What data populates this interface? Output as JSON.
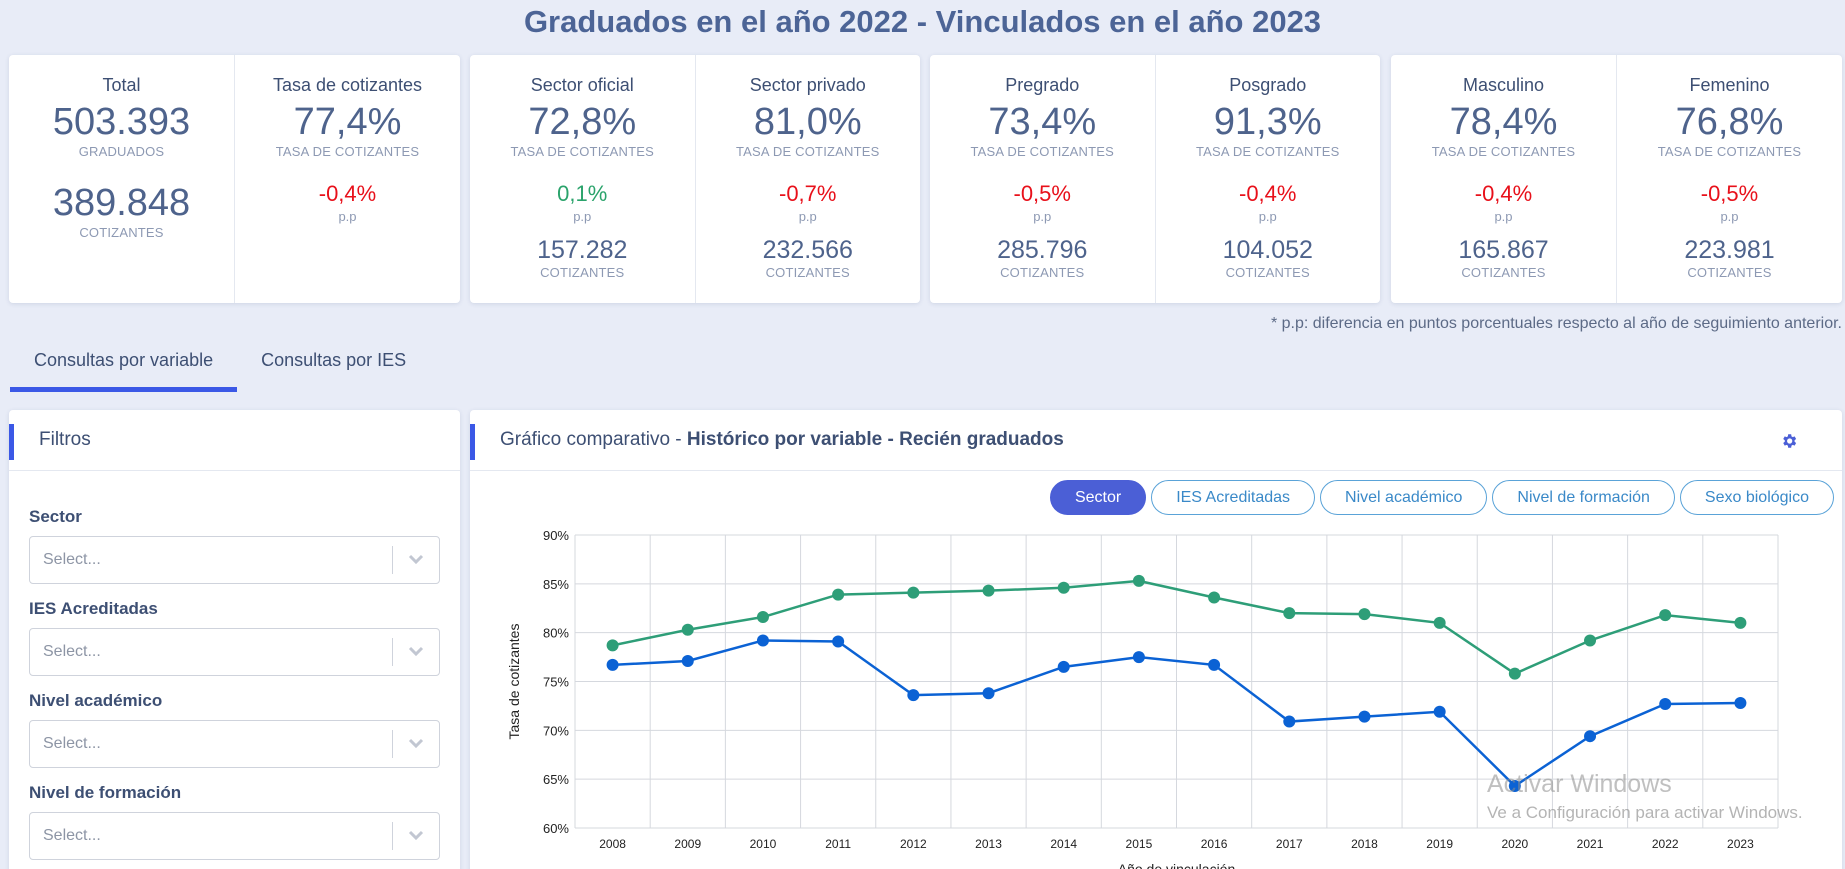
{
  "page_title": "Graduados en el año 2022 - Vinculados en el año 2023",
  "cards": {
    "total": {
      "title": "Total",
      "graduados": "503.393",
      "graduados_label": "GRADUADOS",
      "cotizantes": "389.848",
      "cotizantes_label": "COTIZANTES"
    },
    "tasa": {
      "title": "Tasa de cotizantes",
      "value": "77,4%",
      "label": "TASA DE COTIZANTES",
      "delta": "-0,4%",
      "pp": "p.p"
    },
    "sector_oficial": {
      "title": "Sector oficial",
      "value": "72,8%",
      "label": "TASA DE COTIZANTES",
      "delta": "0,1%",
      "pp": "p.p",
      "count": "157.282",
      "count_label": "COTIZANTES"
    },
    "sector_privado": {
      "title": "Sector privado",
      "value": "81,0%",
      "label": "TASA DE COTIZANTES",
      "delta": "-0,7%",
      "pp": "p.p",
      "count": "232.566",
      "count_label": "COTIZANTES"
    },
    "pregrado": {
      "title": "Pregrado",
      "value": "73,4%",
      "label": "TASA DE COTIZANTES",
      "delta": "-0,5%",
      "pp": "p.p",
      "count": "285.796",
      "count_label": "COTIZANTES"
    },
    "posgrado": {
      "title": "Posgrado",
      "value": "91,3%",
      "label": "TASA DE COTIZANTES",
      "delta": "-0,4%",
      "pp": "p.p",
      "count": "104.052",
      "count_label": "COTIZANTES"
    },
    "masculino": {
      "title": "Masculino",
      "value": "78,4%",
      "label": "TASA DE COTIZANTES",
      "delta": "-0,4%",
      "pp": "p.p",
      "count": "165.867",
      "count_label": "COTIZANTES"
    },
    "femenino": {
      "title": "Femenino",
      "value": "76,8%",
      "label": "TASA DE COTIZANTES",
      "delta": "-0,5%",
      "pp": "p.p",
      "count": "223.981",
      "count_label": "COTIZANTES"
    }
  },
  "footnote": "* p.p: diferencia en puntos porcentuales respecto al año de seguimiento anterior.",
  "tabs": [
    "Consultas por variable",
    "Consultas por IES"
  ],
  "filters": {
    "title": "Filtros",
    "items": [
      {
        "label": "Sector",
        "placeholder": "Select..."
      },
      {
        "label": "IES Acreditadas",
        "placeholder": "Select..."
      },
      {
        "label": "Nivel académico",
        "placeholder": "Select..."
      },
      {
        "label": "Nivel de formación",
        "placeholder": "Select..."
      }
    ]
  },
  "chart_panel": {
    "title_prefix": "Gráfico comparativo - ",
    "title_bold": "Histórico por variable - Recién graduados",
    "segments": [
      "Sector",
      "IES Acreditadas",
      "Nivel académico",
      "Nivel de formación",
      "Sexo biológico"
    ],
    "active_segment": "Sector"
  },
  "colors": {
    "accent": "#3b58e6",
    "series_green": "#2e9e78",
    "series_blue": "#0b62d4",
    "negative": "#e8101a",
    "positive": "#2aa36b"
  },
  "chart_data": {
    "type": "line",
    "x": [
      2008,
      2009,
      2010,
      2011,
      2012,
      2013,
      2014,
      2015,
      2016,
      2017,
      2018,
      2019,
      2020,
      2021,
      2022,
      2023
    ],
    "series": [
      {
        "color": "#2e9e78",
        "values": [
          78.7,
          80.3,
          81.6,
          83.9,
          84.1,
          84.3,
          84.6,
          85.3,
          83.6,
          82.0,
          81.9,
          81.0,
          75.8,
          79.2,
          81.8,
          81.0
        ]
      },
      {
        "color": "#0b62d4",
        "values": [
          76.7,
          77.1,
          79.2,
          79.1,
          73.6,
          73.8,
          76.5,
          77.5,
          76.7,
          70.9,
          71.4,
          71.9,
          64.3,
          69.4,
          72.7,
          72.8
        ]
      }
    ],
    "ylabel": "Tasa de cotizantes",
    "xlabel": "Año de vinculación",
    "ylim": [
      60,
      90
    ],
    "yticks": [
      "60%",
      "65%",
      "70%",
      "75%",
      "80%",
      "85%",
      "90%"
    ],
    "grid": true
  },
  "watermark": {
    "line1": "Activar Windows",
    "line2": "Ve a Configuración para activar Windows."
  }
}
